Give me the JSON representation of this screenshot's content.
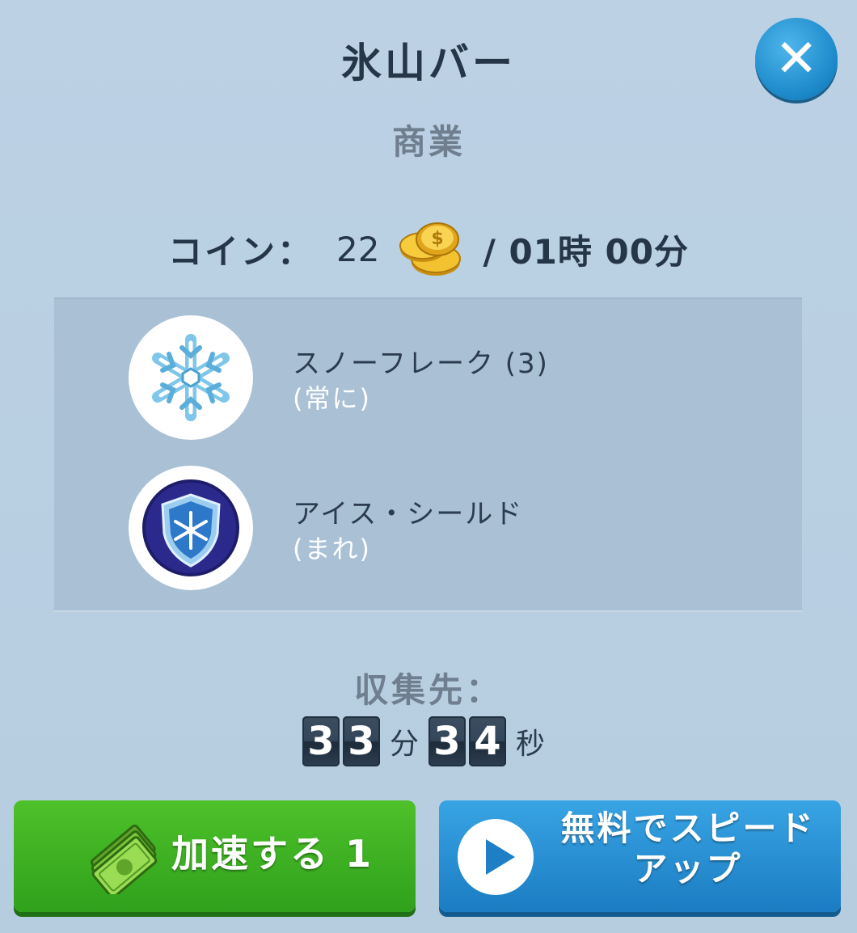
{
  "dialog": {
    "title": "氷山バー",
    "category": "商業",
    "close_icon": "close-icon"
  },
  "income": {
    "label": "コイン：",
    "amount": "22",
    "period": "/ 01時 00分",
    "icon": "coin-stack-icon"
  },
  "traits": [
    {
      "name": "スノーフレーク (3)",
      "rarity": "(常に)",
      "icon": "snowflake-icon"
    },
    {
      "name": "アイス・シールド",
      "rarity": "(まれ)",
      "icon": "ice-shield-icon"
    }
  ],
  "collect": {
    "label": "収集先：",
    "minutes_digits": [
      "3",
      "3"
    ],
    "minutes_unit": "分",
    "seconds_digits": [
      "3",
      "4"
    ],
    "seconds_unit": "秒"
  },
  "buttons": {
    "speed_up": {
      "label": "加速する 1",
      "icon": "cash-icon"
    },
    "free_speed_up": {
      "label_line1": "無料でスピード",
      "label_line2": "アップ",
      "icon": "play-icon"
    }
  },
  "colors": {
    "panel_background": "#b8cfe2",
    "green_button": "#3cb122",
    "blue_button": "#2a8fd4",
    "close_button": "#1e88c9"
  }
}
